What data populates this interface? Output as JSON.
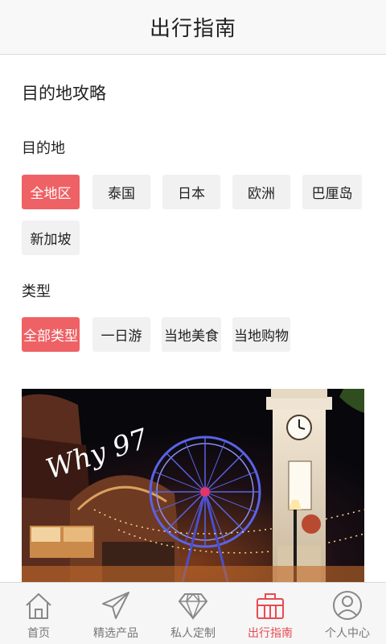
{
  "header": {
    "title": "出行指南"
  },
  "guide": {
    "title": "目的地攻略",
    "destination_label": "目的地",
    "destinations": [
      "全地区",
      "泰国",
      "日本",
      "欧洲",
      "巴厘岛",
      "新加坡"
    ],
    "destination_selected": "全地区",
    "type_label": "类型",
    "types": [
      "全部类型",
      "一日游",
      "当地美食",
      "当地购物"
    ],
    "type_selected": "全部类型",
    "photo_sign_text": "Why 97"
  },
  "tabbar": {
    "active": "出行指南",
    "accent_color": "#e84b52",
    "tabs": [
      {
        "label": "首页",
        "icon": "home-icon"
      },
      {
        "label": "精选产品",
        "icon": "paper-plane-icon"
      },
      {
        "label": "私人定制",
        "icon": "diamond-icon"
      },
      {
        "label": "出行指南",
        "icon": "suitcase-icon"
      },
      {
        "label": "个人中心",
        "icon": "user-icon"
      }
    ]
  },
  "colors": {
    "chip_active": "#ee6165",
    "chip_inactive": "#f1f1f1"
  }
}
